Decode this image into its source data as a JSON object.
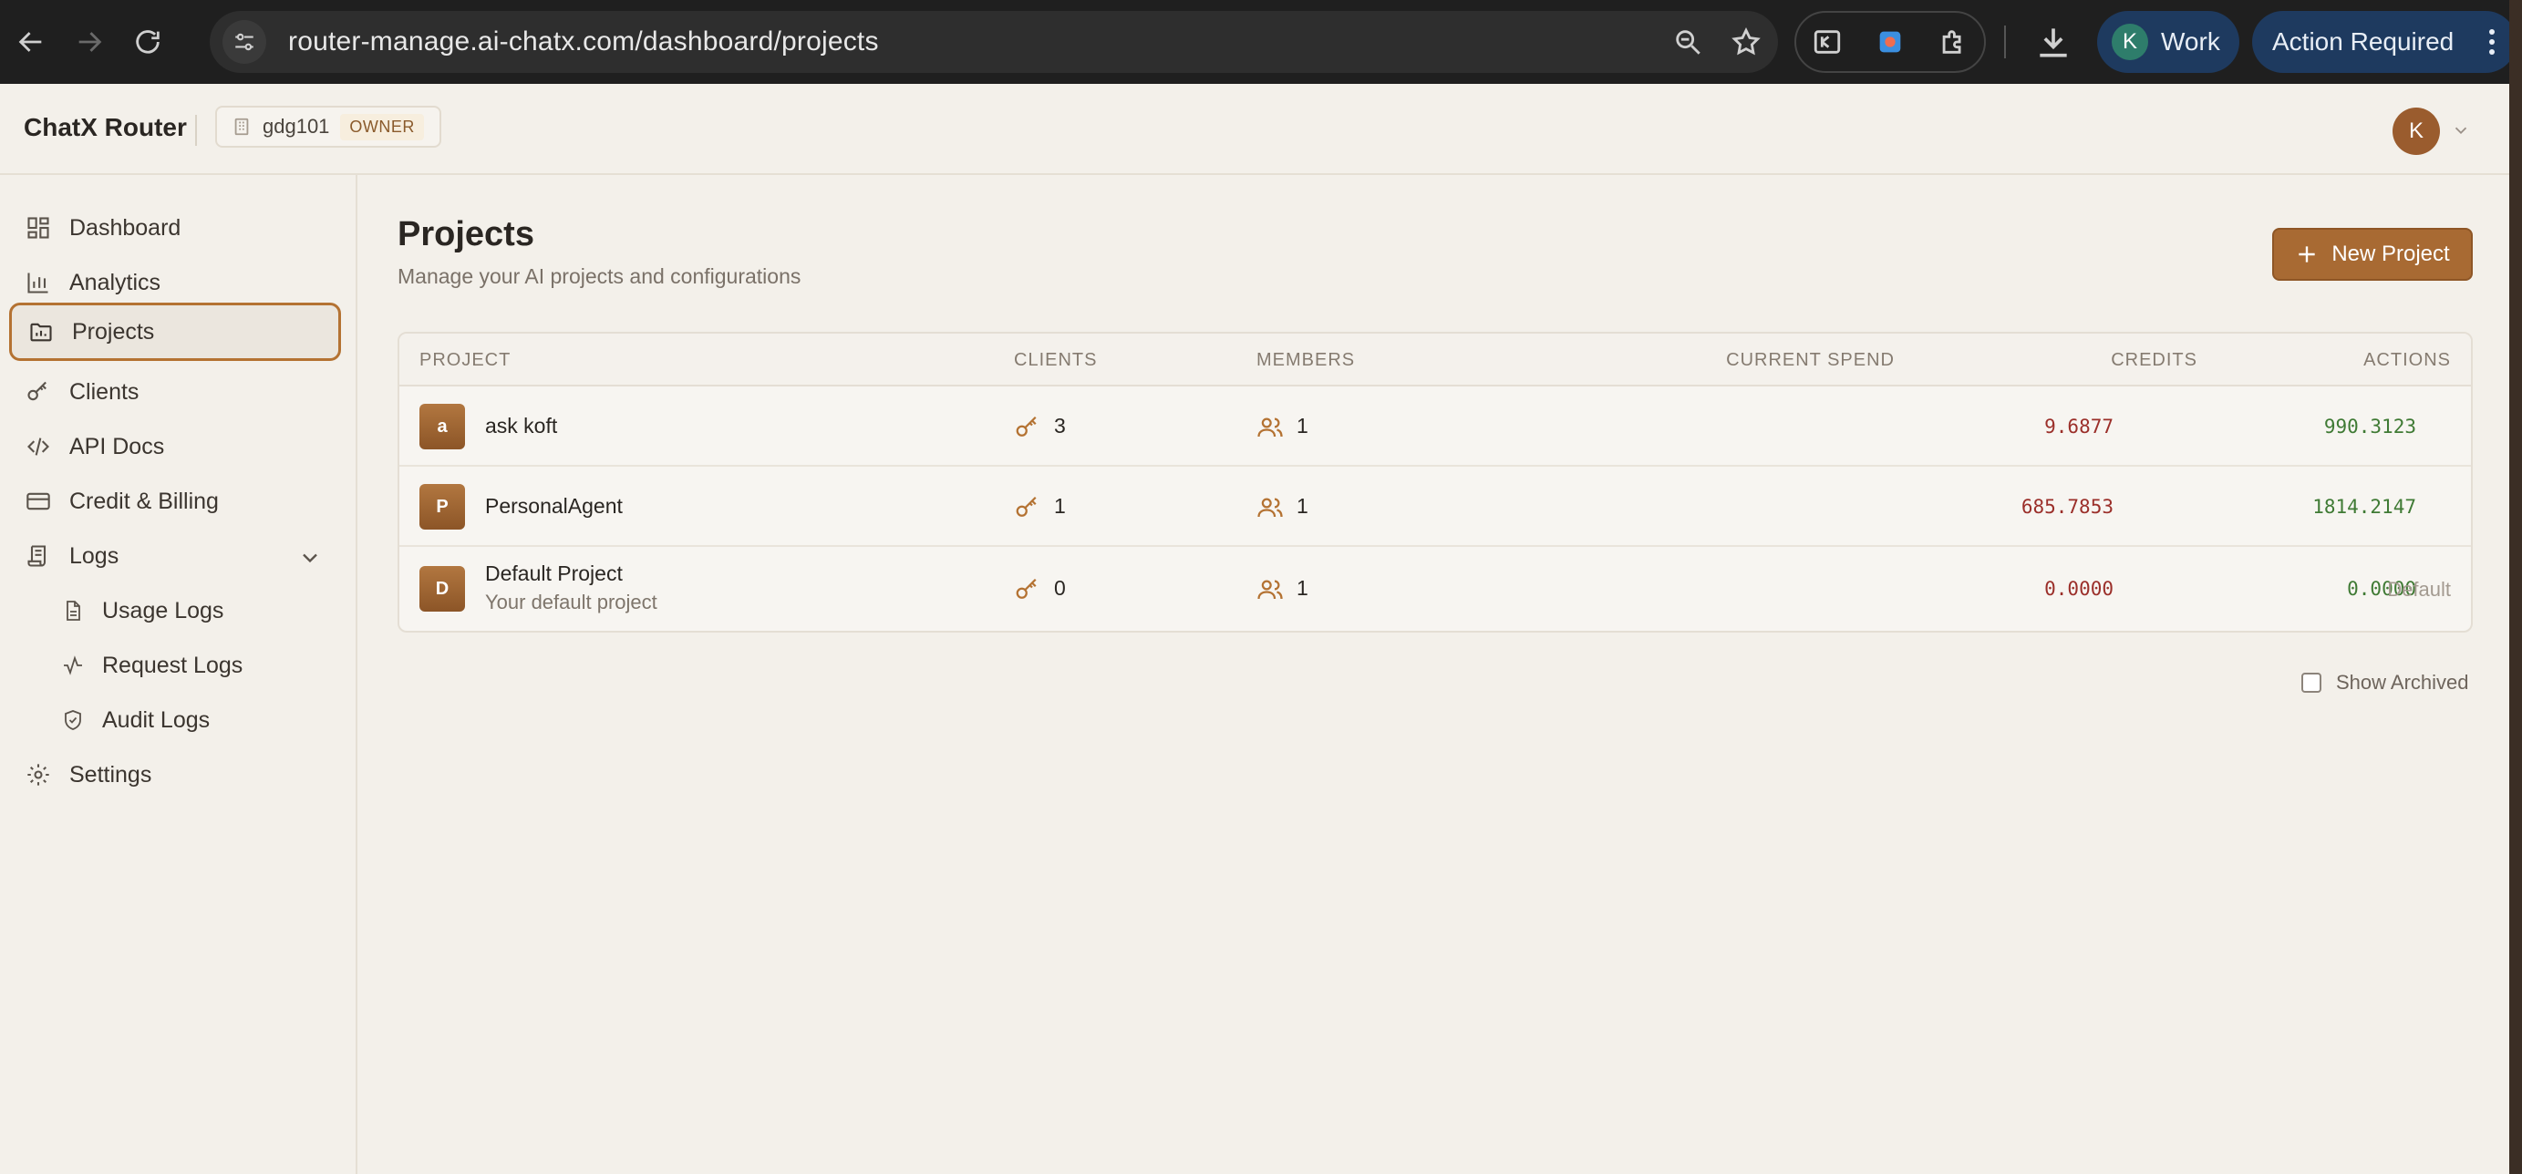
{
  "browser": {
    "url": "router-manage.ai-chatx.com/dashboard/projects",
    "profile_initial": "K",
    "profile_label": "Work",
    "action_label": "Action Required"
  },
  "header": {
    "brand": "ChatX Router",
    "org_name": "gdg101",
    "org_role": "OWNER",
    "user_initial": "K"
  },
  "sidebar": {
    "items": [
      {
        "label": "Dashboard"
      },
      {
        "label": "Analytics"
      },
      {
        "label": "Projects"
      },
      {
        "label": "Clients"
      },
      {
        "label": "API Docs"
      },
      {
        "label": "Credit & Billing"
      },
      {
        "label": "Logs"
      },
      {
        "label": "Usage Logs"
      },
      {
        "label": "Request Logs"
      },
      {
        "label": "Audit Logs"
      },
      {
        "label": "Settings"
      }
    ],
    "active": "Projects"
  },
  "main": {
    "title": "Projects",
    "subtitle": "Manage your AI projects and configurations",
    "new_button": "New Project",
    "show_archived_label": "Show Archived"
  },
  "table": {
    "columns": [
      "PROJECT",
      "CLIENTS",
      "MEMBERS",
      "CURRENT SPEND",
      "CREDITS",
      "ACTIONS"
    ],
    "rows": [
      {
        "initial": "a",
        "name": "ask koft",
        "description": "",
        "clients": "3",
        "members": "1",
        "spend": "9.6877",
        "credits": "990.3123",
        "action": ""
      },
      {
        "initial": "P",
        "name": "PersonalAgent",
        "description": "",
        "clients": "1",
        "members": "1",
        "spend": "685.7853",
        "credits": "1814.2147",
        "action": ""
      },
      {
        "initial": "D",
        "name": "Default Project",
        "description": "Your default project",
        "clients": "0",
        "members": "1",
        "spend": "0.0000",
        "credits": "0.0000",
        "action": "Default"
      }
    ]
  },
  "colors": {
    "accent": "#a86a33",
    "spend": "#9b2f2a",
    "credits": "#3f7a34",
    "background": "#f3f0ea"
  }
}
